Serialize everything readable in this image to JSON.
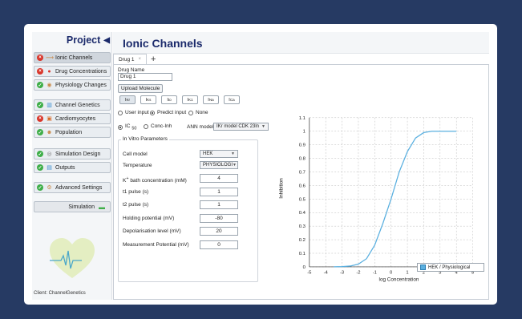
{
  "sidebar": {
    "project_label": "Project",
    "items": [
      {
        "label": "Ionic Channels",
        "status": "err",
        "icon": "ion-icon",
        "glyph": "⟿"
      },
      {
        "label": "Drug Concentrations",
        "status": "err",
        "icon": "drug-icon",
        "glyph": "●"
      },
      {
        "label": "Physiology Changes",
        "status": "ok",
        "icon": "pills-icon",
        "glyph": "◉"
      },
      {
        "label": "Channel Genetics",
        "status": "ok",
        "icon": "bar-chart-icon",
        "glyph": "▥"
      },
      {
        "label": "Cardiomyocytes",
        "status": "err",
        "icon": "cell-icon",
        "glyph": "▣"
      },
      {
        "label": "Population",
        "status": "ok",
        "icon": "people-icon",
        "glyph": "☻"
      },
      {
        "label": "Simulation Design",
        "status": "ok",
        "icon": "design-icon",
        "glyph": "◎"
      },
      {
        "label": "Outputs",
        "status": "ok",
        "icon": "outputs-icon",
        "glyph": "▤"
      },
      {
        "label": "Advanced Settings",
        "status": "ok",
        "icon": "settings-icon",
        "glyph": "⚙"
      }
    ],
    "simulation_label": "Simulation",
    "client_text": "Client: ChannelGenetics"
  },
  "main": {
    "title": "Ionic Channels",
    "tab_label": "Drug 1",
    "drug_name_label": "Drug Name",
    "drug_name_value": "Drug 1",
    "upload_label": "Upload Molecule",
    "channels": [
      {
        "main": "I",
        "sub": "Kr"
      },
      {
        "main": "I",
        "sub": "Ks"
      },
      {
        "main": "I",
        "sub": "to"
      },
      {
        "main": "I",
        "sub": "K1"
      },
      {
        "main": "I",
        "sub": "Na"
      },
      {
        "main": "I",
        "sub": "Ca"
      }
    ],
    "input_options": [
      "User input",
      "Predict input",
      "None"
    ],
    "ic50_label": "IC",
    "ic50_sub": "50",
    "conc_inh_label": "Conc-Inh",
    "ann_model_label": "ANN model",
    "ann_model_value": "IKr model CDK 23ln",
    "in_vitro_title": "In Vitro Parameters",
    "cell_model_label": "Cell model",
    "cell_model_value": "HEK",
    "temperature_label": "Temperature",
    "temperature_value": "PHYSIOLOGI",
    "k_label_main": "K",
    "k_label_sup": "+",
    "k_label_rest": " bath concentration (mM)",
    "k_value": "4",
    "t1_label": "t1 pulse (s)",
    "t1_value": "1",
    "t2_label": "t2 pulse (s)",
    "t2_value": "1",
    "holding_label": "Holding potential (mV)",
    "holding_value": "-80",
    "depol_label": "Depolarisation level (mV)",
    "depol_value": "20",
    "meas_label": "Measurement Potential (mV)",
    "meas_value": "0"
  },
  "chart_data": {
    "type": "line",
    "xlabel": "log Concentration",
    "ylabel": "Inhibition",
    "xlim": [
      -5,
      5
    ],
    "ylim": [
      0,
      1.1
    ],
    "xticks": [
      "-5",
      "-4",
      "-3",
      "-2",
      "-1",
      "0",
      "1",
      "2",
      "3",
      "4",
      "5"
    ],
    "yticks": [
      "0",
      "0.1",
      "0.2",
      "0.3",
      "0.4",
      "0.5",
      "0.6",
      "0.7",
      "0.8",
      "0.9",
      "1",
      "1.1"
    ],
    "grid": true,
    "legend_position": "bottom-right",
    "series": [
      {
        "name": "HEK / Physiological",
        "color": "#5bb0e0",
        "x": [
          -3.5,
          -3.0,
          -2.5,
          -2.0,
          -1.5,
          -1.0,
          -0.5,
          0.0,
          0.5,
          1.0,
          1.5,
          2.0,
          2.5,
          3.0,
          4.0
        ],
        "y": [
          0.0,
          0.002,
          0.006,
          0.02,
          0.06,
          0.16,
          0.32,
          0.5,
          0.7,
          0.85,
          0.95,
          0.99,
          1.0,
          1.0,
          1.0
        ]
      }
    ]
  }
}
